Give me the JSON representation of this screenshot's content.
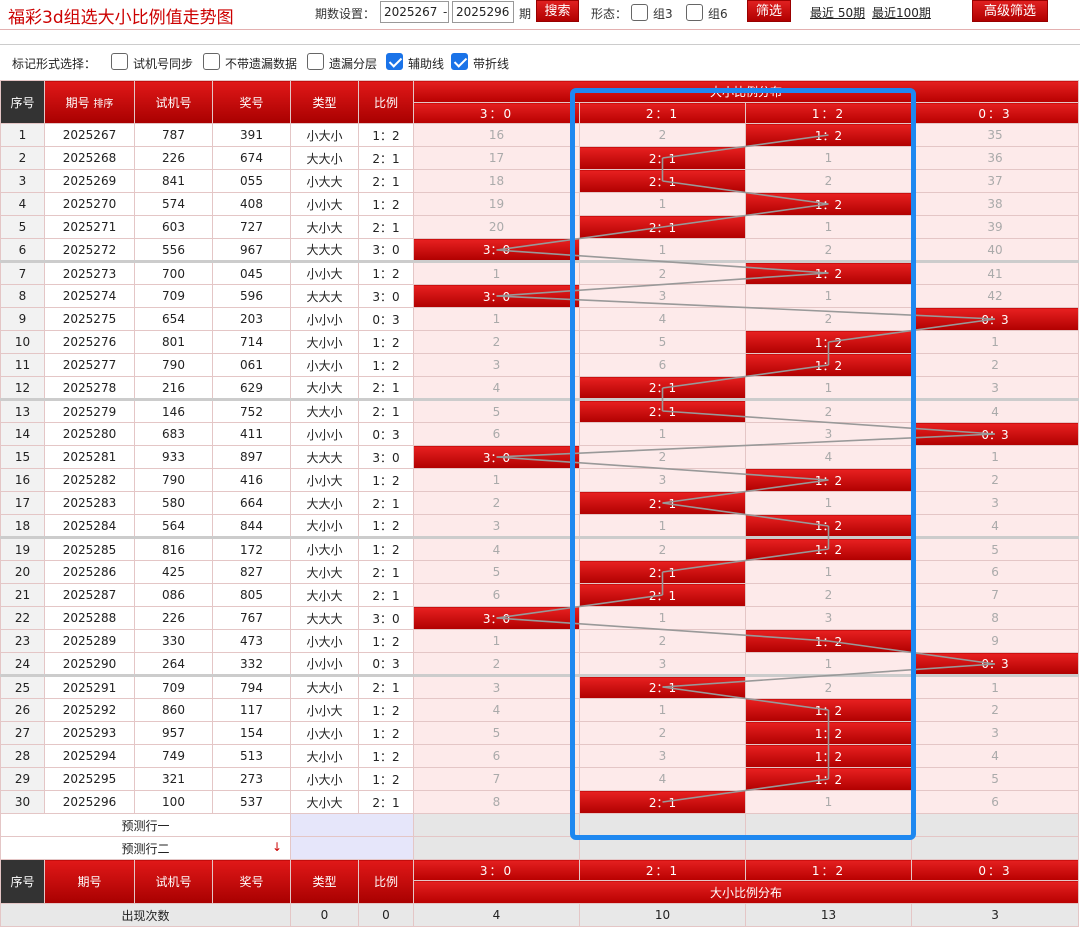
{
  "page_title": "福彩3d组选大小比例值走势图",
  "top": {
    "period_label": "期数设置：",
    "from": "2025267",
    "dash": "-",
    "to": "2025296",
    "period_unit": "期",
    "search": "搜索",
    "shape_label": "形态：",
    "group3": "组3",
    "group6": "组6",
    "filter": "筛选",
    "recent50": "最近 50期",
    "recent100": "最近100期",
    "advanced": "高级筛选"
  },
  "marks": {
    "label": "标记形式选择：",
    "opts": [
      {
        "label": "试机号同步",
        "checked": false
      },
      {
        "label": "不带遗漏数据",
        "checked": false
      },
      {
        "label": "遗漏分层",
        "checked": false
      },
      {
        "label": "辅助线",
        "checked": true
      },
      {
        "label": "带折线",
        "checked": true
      }
    ]
  },
  "headers": {
    "seq": "序号",
    "period": "期号",
    "sort": "排序",
    "trial": "试机号",
    "prize": "奖号",
    "type": "类型",
    "ratio": "比例",
    "dist_title": "大小比例分布",
    "cols": [
      "3：0",
      "2：1",
      "1：2",
      "0：3"
    ]
  },
  "rows": [
    {
      "seq": "1",
      "period": "2025267",
      "trial": "787",
      "prize": "391",
      "type": "小大小",
      "ratio": "1：2",
      "dist": [
        "16",
        "2",
        "1：2",
        "35"
      ],
      "hit": 2
    },
    {
      "seq": "2",
      "period": "2025268",
      "trial": "226",
      "prize": "674",
      "type": "大大小",
      "ratio": "2：1",
      "dist": [
        "17",
        "2：1",
        "1",
        "36"
      ],
      "hit": 1
    },
    {
      "seq": "3",
      "period": "2025269",
      "trial": "841",
      "prize": "055",
      "type": "小大大",
      "ratio": "2：1",
      "dist": [
        "18",
        "2：1",
        "2",
        "37"
      ],
      "hit": 1
    },
    {
      "seq": "4",
      "period": "2025270",
      "trial": "574",
      "prize": "408",
      "type": "小小大",
      "ratio": "1：2",
      "dist": [
        "19",
        "1",
        "1：2",
        "38"
      ],
      "hit": 2
    },
    {
      "seq": "5",
      "period": "2025271",
      "trial": "603",
      "prize": "727",
      "type": "大小大",
      "ratio": "2：1",
      "dist": [
        "20",
        "2：1",
        "1",
        "39"
      ],
      "hit": 1
    },
    {
      "seq": "6",
      "period": "2025272",
      "trial": "556",
      "prize": "967",
      "type": "大大大",
      "ratio": "3：0",
      "dist": [
        "3：0",
        "1",
        "2",
        "40"
      ],
      "hit": 0
    },
    {
      "seq": "7",
      "period": "2025273",
      "trial": "700",
      "prize": "045",
      "type": "小小大",
      "ratio": "1：2",
      "dist": [
        "1",
        "2",
        "1：2",
        "41"
      ],
      "hit": 2
    },
    {
      "seq": "8",
      "period": "2025274",
      "trial": "709",
      "prize": "596",
      "type": "大大大",
      "ratio": "3：0",
      "dist": [
        "3：0",
        "3",
        "1",
        "42"
      ],
      "hit": 0
    },
    {
      "seq": "9",
      "period": "2025275",
      "trial": "654",
      "prize": "203",
      "type": "小小小",
      "ratio": "0：3",
      "dist": [
        "1",
        "4",
        "2",
        "0：3"
      ],
      "hit": 3
    },
    {
      "seq": "10",
      "period": "2025276",
      "trial": "801",
      "prize": "714",
      "type": "大小小",
      "ratio": "1：2",
      "dist": [
        "2",
        "5",
        "1：2",
        "1"
      ],
      "hit": 2
    },
    {
      "seq": "11",
      "period": "2025277",
      "trial": "790",
      "prize": "061",
      "type": "小大小",
      "ratio": "1：2",
      "dist": [
        "3",
        "6",
        "1：2",
        "2"
      ],
      "hit": 2
    },
    {
      "seq": "12",
      "period": "2025278",
      "trial": "216",
      "prize": "629",
      "type": "大小大",
      "ratio": "2：1",
      "dist": [
        "4",
        "2：1",
        "1",
        "3"
      ],
      "hit": 1
    },
    {
      "seq": "13",
      "period": "2025279",
      "trial": "146",
      "prize": "752",
      "type": "大大小",
      "ratio": "2：1",
      "dist": [
        "5",
        "2：1",
        "2",
        "4"
      ],
      "hit": 1
    },
    {
      "seq": "14",
      "period": "2025280",
      "trial": "683",
      "prize": "411",
      "type": "小小小",
      "ratio": "0：3",
      "dist": [
        "6",
        "1",
        "3",
        "0：3"
      ],
      "hit": 3
    },
    {
      "seq": "15",
      "period": "2025281",
      "trial": "933",
      "prize": "897",
      "type": "大大大",
      "ratio": "3：0",
      "dist": [
        "3：0",
        "2",
        "4",
        "1"
      ],
      "hit": 0
    },
    {
      "seq": "16",
      "period": "2025282",
      "trial": "790",
      "prize": "416",
      "type": "小小大",
      "ratio": "1：2",
      "dist": [
        "1",
        "3",
        "1：2",
        "2"
      ],
      "hit": 2
    },
    {
      "seq": "17",
      "period": "2025283",
      "trial": "580",
      "prize": "664",
      "type": "大大小",
      "ratio": "2：1",
      "dist": [
        "2",
        "2：1",
        "1",
        "3"
      ],
      "hit": 1
    },
    {
      "seq": "18",
      "period": "2025284",
      "trial": "564",
      "prize": "844",
      "type": "大小小",
      "ratio": "1：2",
      "dist": [
        "3",
        "1",
        "1：2",
        "4"
      ],
      "hit": 2
    },
    {
      "seq": "19",
      "period": "2025285",
      "trial": "816",
      "prize": "172",
      "type": "小大小",
      "ratio": "1：2",
      "dist": [
        "4",
        "2",
        "1：2",
        "5"
      ],
      "hit": 2
    },
    {
      "seq": "20",
      "period": "2025286",
      "trial": "425",
      "prize": "827",
      "type": "大小大",
      "ratio": "2：1",
      "dist": [
        "5",
        "2：1",
        "1",
        "6"
      ],
      "hit": 1
    },
    {
      "seq": "21",
      "period": "2025287",
      "trial": "086",
      "prize": "805",
      "type": "大小大",
      "ratio": "2：1",
      "dist": [
        "6",
        "2：1",
        "2",
        "7"
      ],
      "hit": 1
    },
    {
      "seq": "22",
      "period": "2025288",
      "trial": "226",
      "prize": "767",
      "type": "大大大",
      "ratio": "3：0",
      "dist": [
        "3：0",
        "1",
        "3",
        "8"
      ],
      "hit": 0
    },
    {
      "seq": "23",
      "period": "2025289",
      "trial": "330",
      "prize": "473",
      "type": "小大小",
      "ratio": "1：2",
      "dist": [
        "1",
        "2",
        "1：2",
        "9"
      ],
      "hit": 2
    },
    {
      "seq": "24",
      "period": "2025290",
      "trial": "264",
      "prize": "332",
      "type": "小小小",
      "ratio": "0：3",
      "dist": [
        "2",
        "3",
        "1",
        "0：3"
      ],
      "hit": 3
    },
    {
      "seq": "25",
      "period": "2025291",
      "trial": "709",
      "prize": "794",
      "type": "大大小",
      "ratio": "2：1",
      "dist": [
        "3",
        "2：1",
        "2",
        "1"
      ],
      "hit": 1
    },
    {
      "seq": "26",
      "period": "2025292",
      "trial": "860",
      "prize": "117",
      "type": "小小大",
      "ratio": "1：2",
      "dist": [
        "4",
        "1",
        "1：2",
        "2"
      ],
      "hit": 2
    },
    {
      "seq": "27",
      "period": "2025293",
      "trial": "957",
      "prize": "154",
      "type": "小大小",
      "ratio": "1：2",
      "dist": [
        "5",
        "2",
        "1：2",
        "3"
      ],
      "hit": 2
    },
    {
      "seq": "28",
      "period": "2025294",
      "trial": "749",
      "prize": "513",
      "type": "大小小",
      "ratio": "1：2",
      "dist": [
        "6",
        "3",
        "1：2",
        "4"
      ],
      "hit": 2
    },
    {
      "seq": "29",
      "period": "2025295",
      "trial": "321",
      "prize": "273",
      "type": "小大小",
      "ratio": "1：2",
      "dist": [
        "7",
        "4",
        "1：2",
        "5"
      ],
      "hit": 2
    },
    {
      "seq": "30",
      "period": "2025296",
      "trial": "100",
      "prize": "537",
      "type": "大小大",
      "ratio": "2：1",
      "dist": [
        "8",
        "2：1",
        "1",
        "6"
      ],
      "hit": 1
    }
  ],
  "predict": {
    "row1": "预测行一",
    "row2": "预测行二",
    "arrow": "↓"
  },
  "footer": {
    "label": "出现次数",
    "type_count": "0",
    "ratio_count": "0",
    "counts": [
      "4",
      "10",
      "13",
      "3"
    ]
  },
  "colors": {
    "accent": "#cc0000",
    "highlight_box": "#1e88f0",
    "trend_line": "#999999"
  }
}
